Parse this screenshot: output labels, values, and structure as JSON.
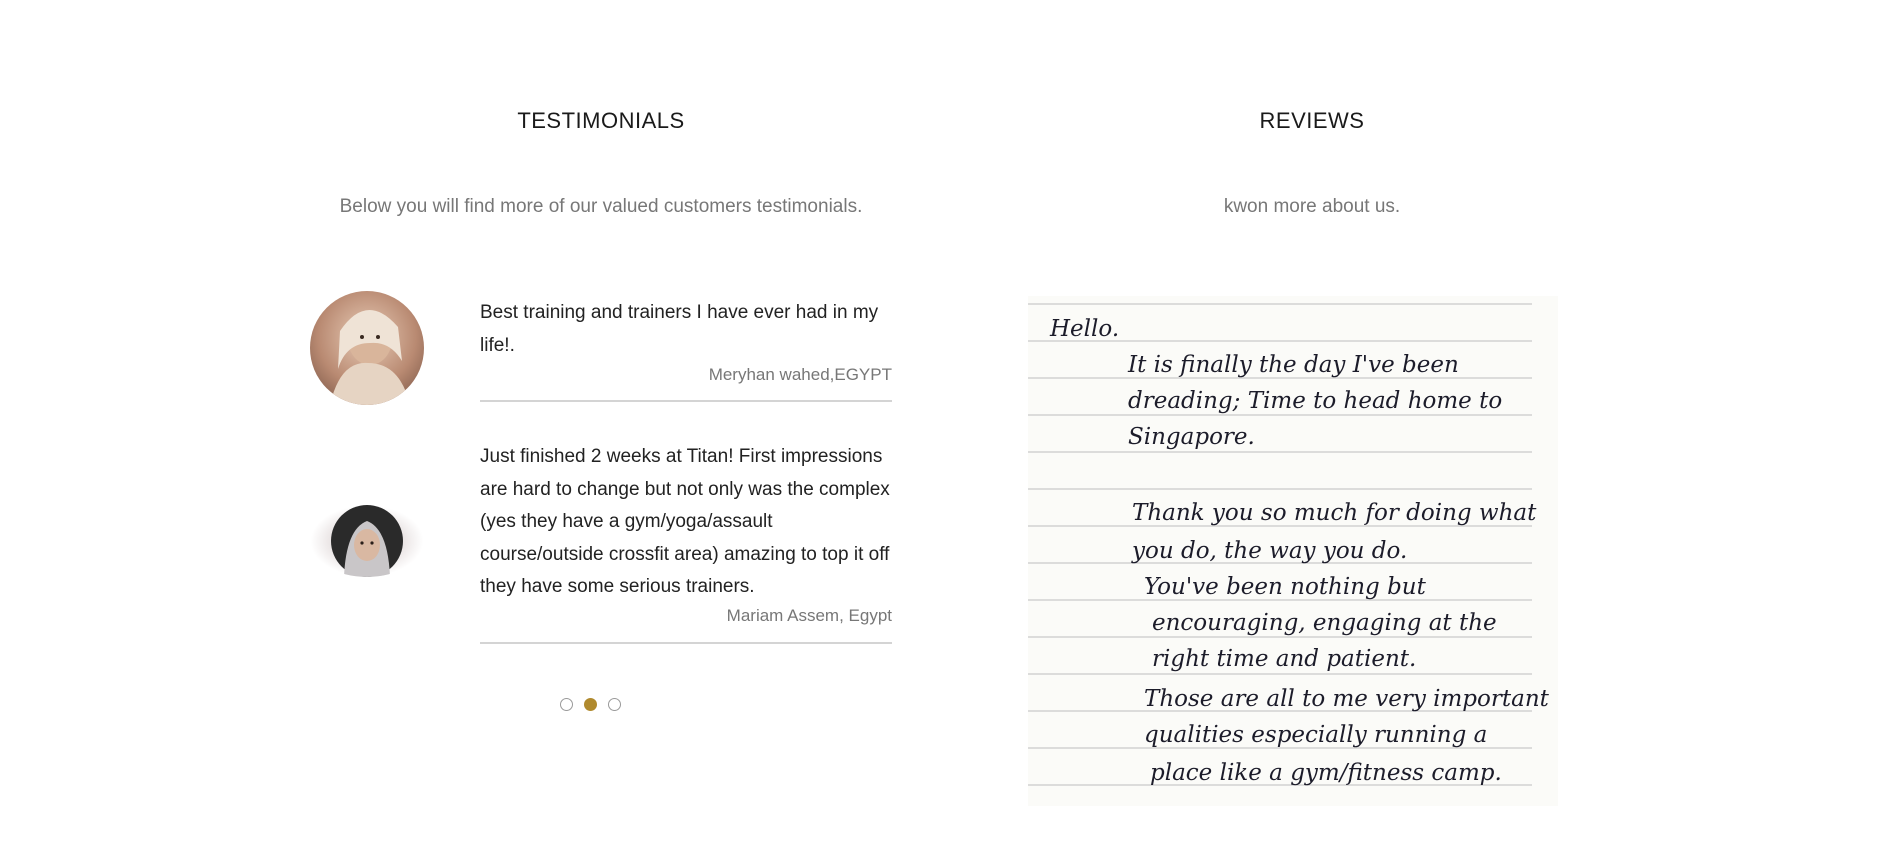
{
  "testimonials": {
    "title": "TESTIMONIALS",
    "subtitle": "Below you will find more of our valued customers testimonials.",
    "items": [
      {
        "quote": "Best training and trainers I have ever had in my life!.",
        "author": "Meryhan wahed,EGYPT"
      },
      {
        "quote": "Just finished 2 weeks at Titan! First impressions are hard to change but not only was the complex (yes they have a gym/yoga/assault course/outside crossfit area) amazing to top it off they have some serious trainers.",
        "author": "Mariam Assem, Egypt"
      }
    ],
    "pagination": {
      "total": 3,
      "active_index": 1
    },
    "accent_color": "#b08a2e"
  },
  "reviews": {
    "title": "REVIEWS",
    "subtitle": "kwon more about us.",
    "note_lines": [
      "Hello.",
      "It is finally the day I've been",
      "dreading; Time to head home to",
      "Singapore.",
      "Thank you so much for doing what",
      "you do, the way you do.",
      "You've been nothing but",
      "encouraging, engaging at the",
      "right time and patient.",
      "Those are all to me very important",
      "qualities especially running a",
      "place like a gym/fitness camp."
    ]
  }
}
